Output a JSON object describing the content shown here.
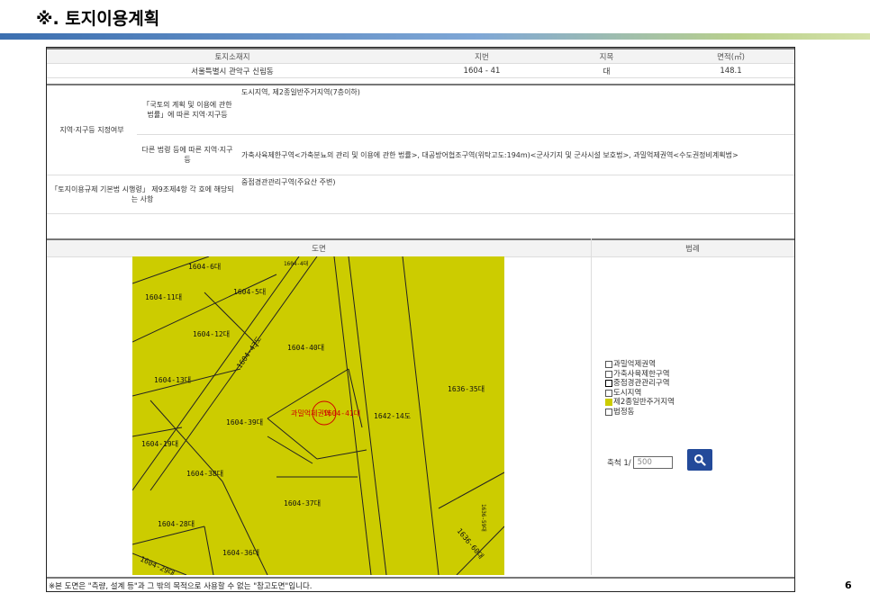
{
  "title": "※. 토지이용계획",
  "page_number": "6",
  "land_info": {
    "headers": [
      "토지소재지",
      "지번",
      "지목",
      "면적(㎡)"
    ],
    "values": [
      "서울특별시 관악구 신림동",
      "1604 - 41",
      "대",
      "148.1"
    ]
  },
  "zoning": {
    "group_label": "지역·지구등 지정여부",
    "row1_label": "「국토의 계획 및 이용에 관한 법률」에 따른 지역·지구등",
    "row1_value": "도시지역, 제2종일반주거지역(7층이하)",
    "row2_label": "다른 법령 등에 따른 지역·지구등",
    "row2_value": "가축사육제한구역<가축분뇨의 관리 및 이용에 관한 법률>, 대공방어협조구역(위탁고도:194m)<군사기지 및 군사시설 보호법>, 과밀억제권역<수도권정비계획법>",
    "row3_label": "「토지이용규제 기본법 시행령」 제9조제4항 각 호에 해당되는 사항",
    "row3_value": "중점경관관리구역(주요산 주변)"
  },
  "map_section": {
    "map_header": "도면",
    "legend_header": "범례",
    "parcels": [
      "1604-6대",
      "1604-4대",
      "1604-11대",
      "1604-5대",
      "1604-12대",
      "1604-43도",
      "1604-40대",
      "1604-13대",
      "1636-35대",
      "1604-39대",
      "1642-14도",
      "1604-19대",
      "1604-38대",
      "1604-37대",
      "1604-28대",
      "1604-36대",
      "1604-29대",
      "1636-60대",
      "1636-59대"
    ],
    "target_label": "1604-41대",
    "target_zone_label": "과밀억제권역",
    "map_fill_color": "#cccc00"
  },
  "legend": {
    "items": [
      {
        "label": "과밀억제권역",
        "swatch": "#ffffff"
      },
      {
        "label": "가축사육제한구역",
        "swatch": "#ffffff"
      },
      {
        "label": "중점경관관리구역",
        "swatch": "#ffffff"
      },
      {
        "label": "도시지역",
        "swatch": "#ffffff"
      },
      {
        "label": "제2종일반주거지역",
        "swatch": "#cccc00"
      },
      {
        "label": "법정동",
        "swatch": "#ffffff"
      }
    ],
    "scale_label": "축척 1/",
    "scale_value": "500"
  },
  "footnote": "※본 도면은 \"측량, 설계 등\"과 그 밖의 목적으로 사용할 수 없는 \"참고도면\"입니다."
}
